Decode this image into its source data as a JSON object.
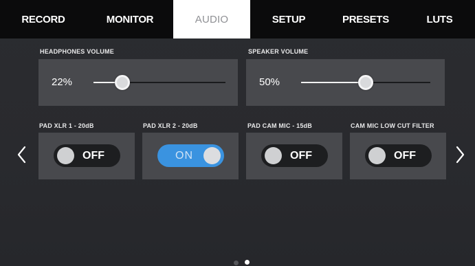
{
  "tabs": [
    {
      "label": "RECORD",
      "active": false
    },
    {
      "label": "MONITOR",
      "active": false
    },
    {
      "label": "AUDIO",
      "active": true
    },
    {
      "label": "SETUP",
      "active": false
    },
    {
      "label": "PRESETS",
      "active": false
    },
    {
      "label": "LUTS",
      "active": false
    }
  ],
  "headphones": {
    "label": "HEADPHONES VOLUME",
    "value_text": "22%",
    "level": 0.22
  },
  "speaker": {
    "label": "SPEAKER VOLUME",
    "value_text": "50%",
    "level": 0.5
  },
  "toggles": [
    {
      "label": "PAD XLR 1 - 20dB",
      "state": "OFF",
      "on": false
    },
    {
      "label": "PAD XLR 2 - 20dB",
      "state": "ON",
      "on": true
    },
    {
      "label": "PAD CAM MIC - 15dB",
      "state": "OFF",
      "on": false
    },
    {
      "label": "CAM MIC LOW CUT FILTER",
      "state": "OFF",
      "on": false
    }
  ],
  "nav": {
    "prev_icon": "chevron-left-icon",
    "next_icon": "chevron-right-icon"
  },
  "pagination": {
    "pages": 2,
    "current": 2
  },
  "colors": {
    "toggle_on": "#3a93e0",
    "toggle_off": "#1d1e20",
    "panel": "#48494d",
    "tabbar": "#0b0b0c"
  }
}
